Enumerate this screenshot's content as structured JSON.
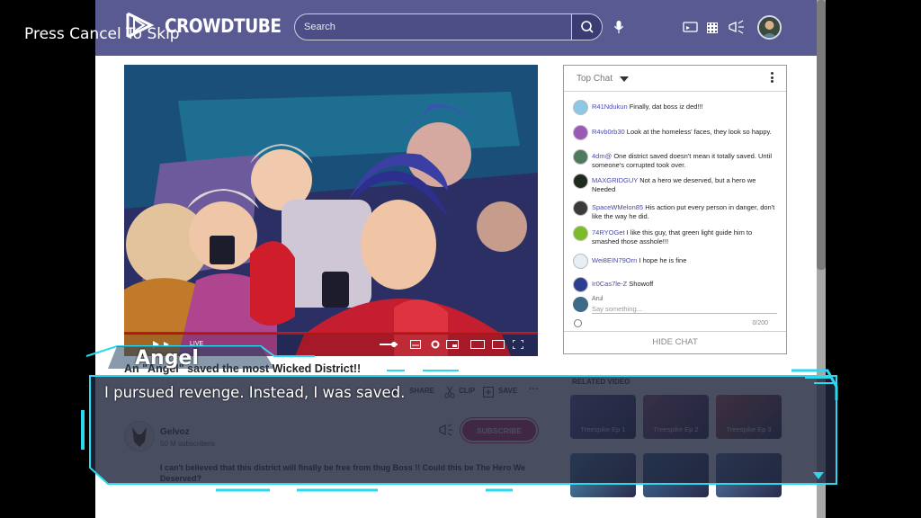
{
  "skip_hint": "Press Cancel To Skip",
  "header": {
    "brand": "CROWDTUBE",
    "search_placeholder": "Search",
    "icons": [
      "search-icon",
      "microphone-icon",
      "cast-icon",
      "apps-grid-icon",
      "megaphone-icon",
      "avatar"
    ]
  },
  "video": {
    "live_label": "LIVE",
    "title": "An \"Angel\" saved the most Wicked District!!",
    "actions": [
      "SHARE",
      "CLIP",
      "SAVE"
    ]
  },
  "channel": {
    "name": "Gelvoz",
    "subscribers": "50 M subscribers",
    "subscribe_label": "SUBSCRIBE",
    "description": "I can't believed that this district will finally be free from thug Boss !! Could this be The Hero We Deserved?"
  },
  "chat": {
    "mode": "Top Chat",
    "messages": [
      {
        "user": "R41Ndukun",
        "text": "Finally, dat boss iz ded!!!",
        "color": "#8fc7e6"
      },
      {
        "user": "R4vb0rb30",
        "text": "Look at the homeless' faces, they look so happy.",
        "color": "#9b59b6"
      },
      {
        "user": "4dm@",
        "text": "One district saved doesn't mean it totally saved. Until someone's corrupted took over.",
        "color": "#4e7a5e"
      },
      {
        "user": "MAXGRIDGUY",
        "text": "Not a hero we deserved, but a hero we Needed",
        "color": "#1f2a1f"
      },
      {
        "user": "SpaceWMelon85",
        "text": "His action put every person in danger, don't like the way he did.",
        "color": "#3a3a3a"
      },
      {
        "user": "74RYOGet",
        "text": "I like this guy, that green light guide him to smashed those asshole!!!",
        "color": "#7dbb2a"
      },
      {
        "user": "Wei8EIN79Orn",
        "text": "I hope he is fine",
        "color": "#e8eef5"
      },
      {
        "user": "Ir0Cas7le-Z",
        "text": "Showoff",
        "color": "#2c3e8f"
      }
    ],
    "reply_user": "Arul",
    "reply_placeholder": "Say something...",
    "counter": "0/200",
    "hide_label": "HIDE CHAT"
  },
  "related": {
    "label": "RELATED VIDEO",
    "items": [
      "Treespike Ep 1",
      "Treespike Ep 2",
      "Treespike Ep 3",
      "",
      "",
      ""
    ]
  },
  "dialogue": {
    "speaker": "Angel",
    "line": "I pursued revenge. Instead, I was saved."
  },
  "colors": {
    "header": "#5a5a93",
    "dialog_frame": "#2ad8f0",
    "subscribe": "#cf2f66",
    "progress": "#d01a1a"
  }
}
